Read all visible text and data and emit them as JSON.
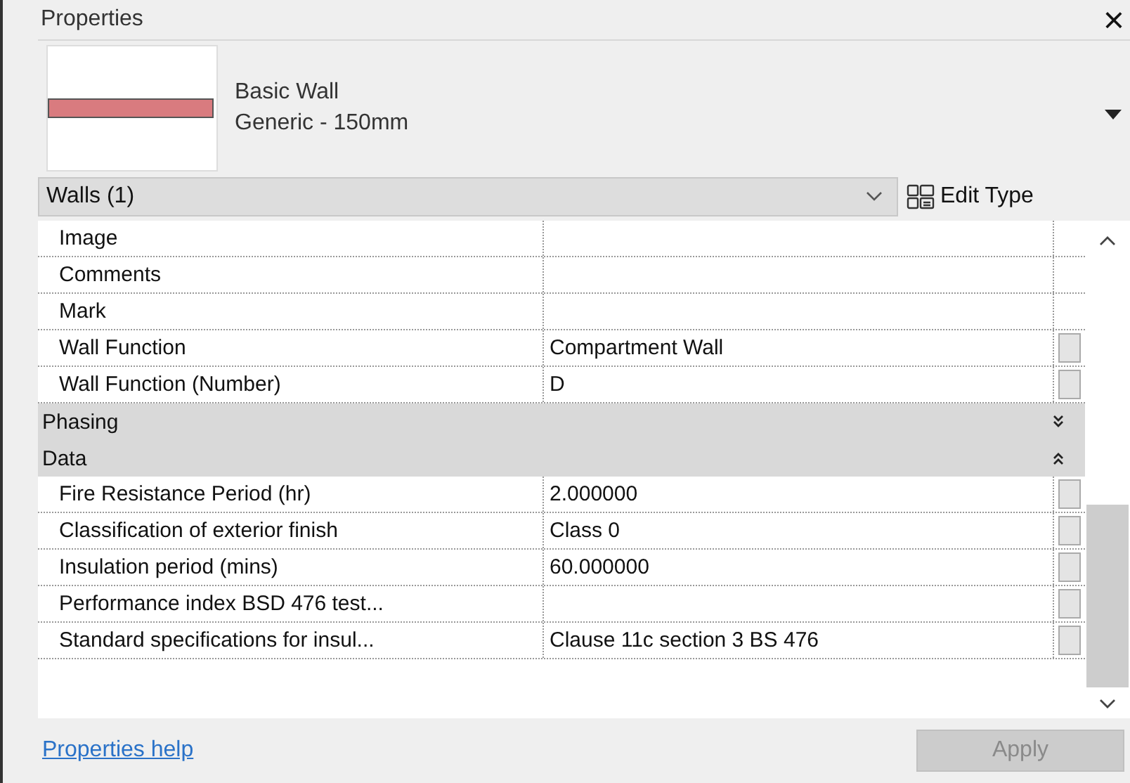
{
  "panel": {
    "title": "Properties",
    "close": "×"
  },
  "type_selector": {
    "family": "Basic Wall",
    "type": "Generic - 150mm"
  },
  "filter": {
    "value": "Walls (1)",
    "edit_type": "Edit Type"
  },
  "items": [
    {
      "kind": "property",
      "name": "Image",
      "value": "",
      "has_button": false
    },
    {
      "kind": "property",
      "name": "Comments",
      "value": "",
      "has_button": false
    },
    {
      "kind": "property",
      "name": "Mark",
      "value": "",
      "has_button": false
    },
    {
      "kind": "property",
      "name": "Wall Function",
      "value": "Compartment Wall",
      "has_button": true
    },
    {
      "kind": "property",
      "name": "Wall Function (Number)",
      "value": "D",
      "has_button": true
    },
    {
      "kind": "group",
      "name": "Phasing",
      "expanded": false
    },
    {
      "kind": "group",
      "name": "Data",
      "expanded": true
    },
    {
      "kind": "property",
      "name": "Fire Resistance Period (hr)",
      "value": "2.000000",
      "has_button": true
    },
    {
      "kind": "property",
      "name": "Classification of exterior finish",
      "value": "Class 0",
      "has_button": true
    },
    {
      "kind": "property",
      "name": "Insulation period (mins)",
      "value": "60.000000",
      "has_button": true
    },
    {
      "kind": "property",
      "name": "Performance index BSD 476 test...",
      "value": "",
      "has_button": true
    },
    {
      "kind": "property",
      "name": "Standard specifications for insul...",
      "value": "Clause 11c section 3 BS 476",
      "has_button": true
    }
  ],
  "footer": {
    "help_link": "Properties help",
    "apply": {
      "label": "Apply",
      "disabled": true
    }
  }
}
